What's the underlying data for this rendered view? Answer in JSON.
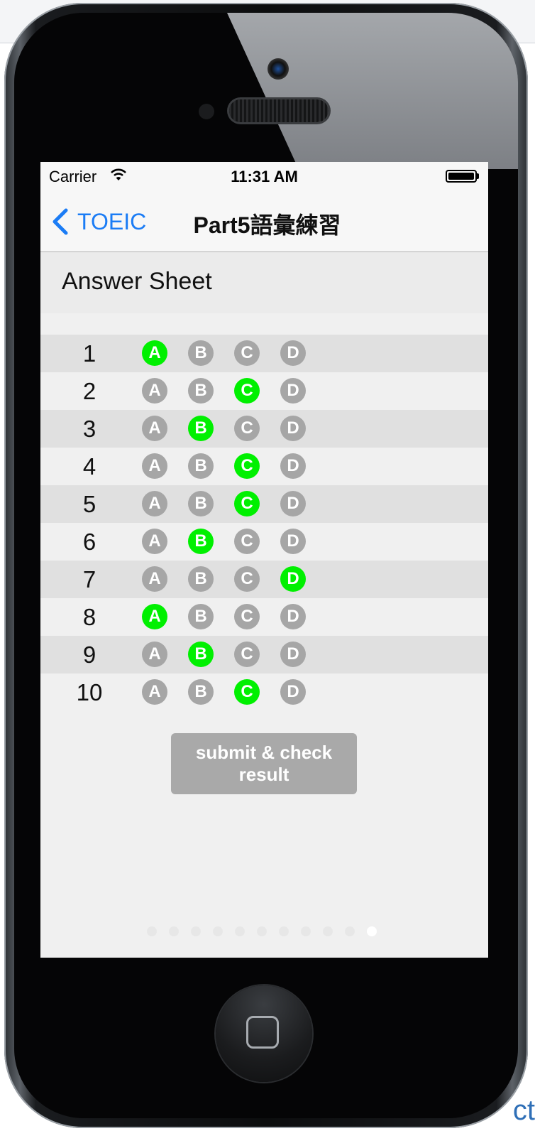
{
  "statusbar": {
    "carrier": "Carrier",
    "time": "11:31 AM"
  },
  "navbar": {
    "back_label": "TOEIC",
    "title": "Part5語彙練習"
  },
  "sheet": {
    "title": "Answer Sheet",
    "questions": [
      {
        "number": "1",
        "selected": "A"
      },
      {
        "number": "2",
        "selected": "C"
      },
      {
        "number": "3",
        "selected": "B"
      },
      {
        "number": "4",
        "selected": "C"
      },
      {
        "number": "5",
        "selected": "C"
      },
      {
        "number": "6",
        "selected": "B"
      },
      {
        "number": "7",
        "selected": "D"
      },
      {
        "number": "8",
        "selected": "A"
      },
      {
        "number": "9",
        "selected": "B"
      },
      {
        "number": "10",
        "selected": "C"
      }
    ],
    "options": [
      "A",
      "B",
      "C",
      "D"
    ]
  },
  "submit": {
    "label": "submit & check result"
  },
  "pager": {
    "page_count": 11,
    "current_page": 11
  },
  "colors": {
    "accent": "#1b7cf5",
    "selected": "#00f000",
    "unselected": "#a6a6a6"
  },
  "background": {
    "edge_text": "ct"
  }
}
